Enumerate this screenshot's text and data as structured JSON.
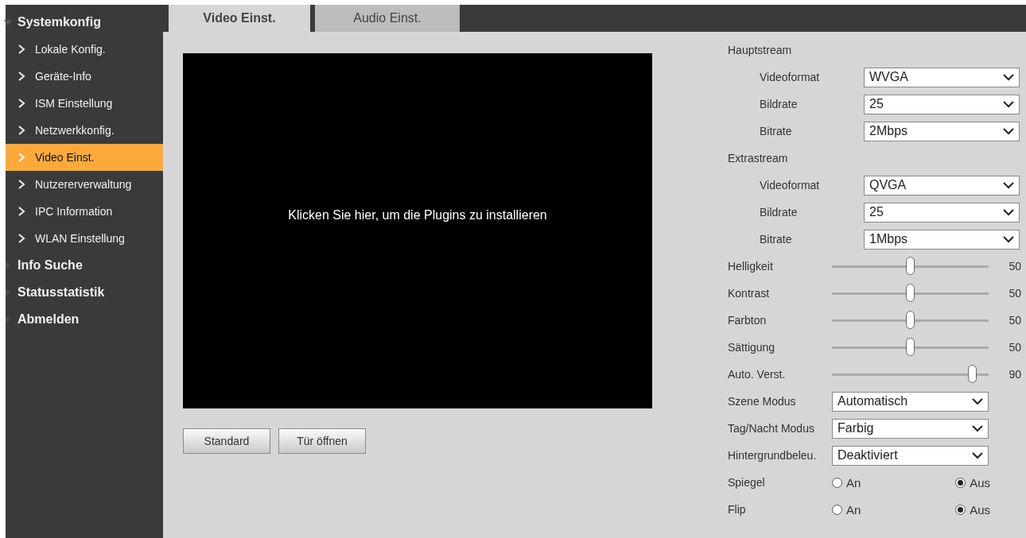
{
  "sidebar": {
    "groups": [
      {
        "label": "Systemkonfig",
        "expanded": true,
        "children": [
          {
            "label": "Lokale Konfig.",
            "selected": false
          },
          {
            "label": "Geräte-Info",
            "selected": false
          },
          {
            "label": "ISM Einstellung",
            "selected": false
          },
          {
            "label": "Netzwerkkonfig.",
            "selected": false
          },
          {
            "label": "Video Einst.",
            "selected": true
          },
          {
            "label": "Nutzererverwaltung",
            "selected": false
          },
          {
            "label": "IPC Information",
            "selected": false
          },
          {
            "label": "WLAN Einstellung",
            "selected": false
          }
        ]
      },
      {
        "label": "Info Suche",
        "expanded": false
      },
      {
        "label": "Statusstatistik",
        "expanded": false
      },
      {
        "label": "Abmelden",
        "expanded": false
      }
    ]
  },
  "tabs": [
    {
      "label": "Video Einst.",
      "selected": true
    },
    {
      "label": "Audio Einst.",
      "selected": false
    }
  ],
  "video": {
    "message": "Klicken Sie hier, um die Plugins zu installieren"
  },
  "buttons": [
    "Standard",
    "Tür öffnen"
  ],
  "streams": [
    {
      "title": "Hauptstream",
      "fields": [
        {
          "label": "Videoformat",
          "value": "WVGA"
        },
        {
          "label": "Bildrate",
          "value": "25"
        },
        {
          "label": "Bitrate",
          "value": "2Mbps"
        }
      ]
    },
    {
      "title": "Extrastream",
      "fields": [
        {
          "label": "Videoformat",
          "value": "QVGA"
        },
        {
          "label": "Bildrate",
          "value": "25"
        },
        {
          "label": "Bitrate",
          "value": "1Mbps"
        }
      ]
    }
  ],
  "sliders": [
    {
      "label": "Helligkeit",
      "level": 0.5,
      "reading": "50"
    },
    {
      "label": "Kontrast",
      "level": 0.5,
      "reading": "50"
    },
    {
      "label": "Farbton",
      "level": 0.5,
      "reading": "50"
    },
    {
      "label": "Sättigung",
      "level": 0.5,
      "reading": "50"
    },
    {
      "label": "Auto. Verst.",
      "level": 0.9,
      "reading": "90"
    }
  ],
  "modes": [
    {
      "label": "Szene Modus",
      "value": "Automatisch"
    },
    {
      "label": "Tag/Nacht Modus",
      "value": "Farbig"
    },
    {
      "label": "Hintergrundbeleu.",
      "value": "Deaktiviert"
    }
  ],
  "toggles": [
    {
      "label": "Spiegel",
      "options": [
        {
          "label": "An",
          "selected": false
        },
        {
          "label": "Aus",
          "selected": true
        }
      ]
    },
    {
      "label": "Flip",
      "options": [
        {
          "label": "An",
          "selected": false
        },
        {
          "label": "Aus",
          "selected": true
        }
      ]
    }
  ]
}
